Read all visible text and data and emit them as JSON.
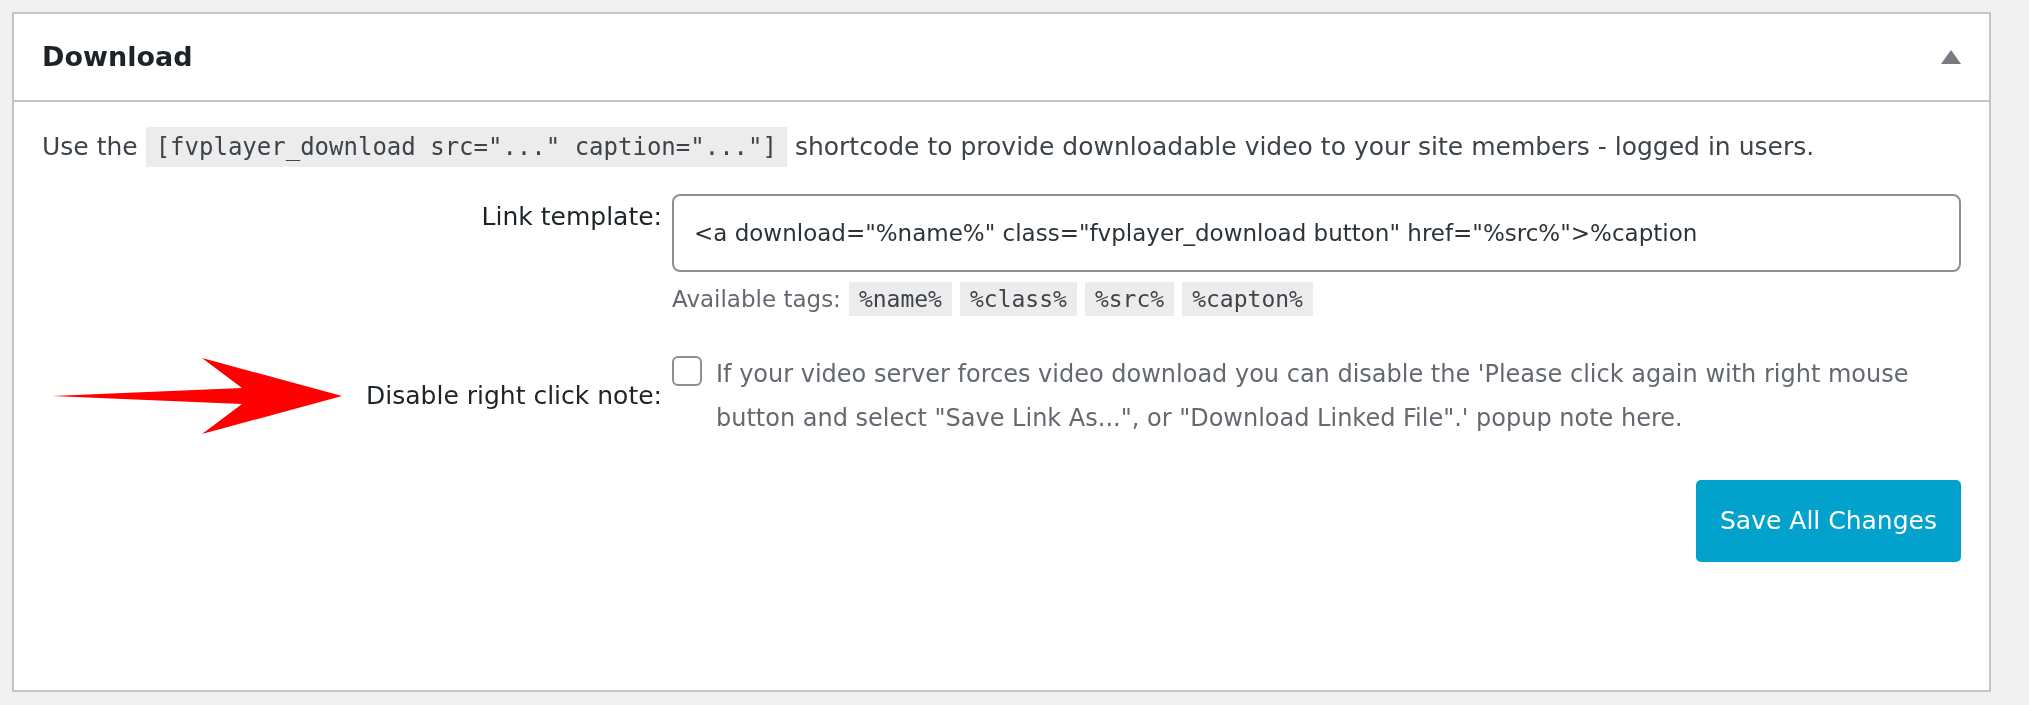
{
  "panel": {
    "title": "Download",
    "expanded": true
  },
  "intro": {
    "before": "Use the",
    "code": "[fvplayer_download src=\"...\" caption=\"...\"]",
    "after": "shortcode to provide downloadable video to your site members - logged in users."
  },
  "fields": [
    {
      "kind": "text",
      "label": "Link template:",
      "value": "<a download=\"%name%\" class=\"fvplayer_download button\" href=\"%src%\">%caption",
      "hint": "Available tags:",
      "tags": [
        "%name%",
        "%class%",
        "%src%",
        "%capton%"
      ]
    },
    {
      "kind": "checkbox",
      "label": "Disable right click note:",
      "checked": false,
      "description": "If your video server forces video download you can disable the 'Please click again with right mouse button and select \"Save Link As...\", or \"Download Linked File\".' popup note here."
    }
  ],
  "save_button": "Save All Changes"
}
